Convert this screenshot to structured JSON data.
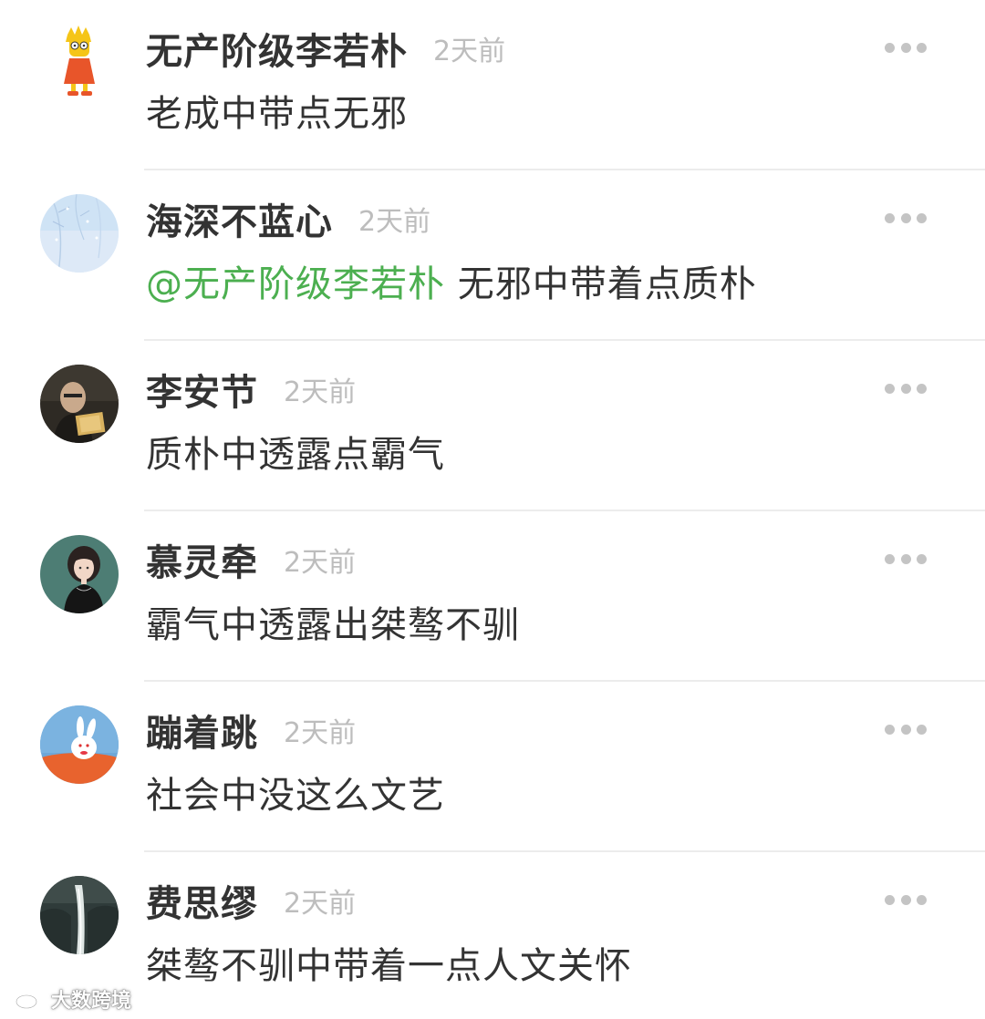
{
  "comments": [
    {
      "avatar_icon": "cartoon-girl-avatar",
      "name": "无产阶级李若朴",
      "time": "2天前",
      "text": "老成中带点无邪",
      "mention": ""
    },
    {
      "avatar_icon": "pale-blue-branches-avatar",
      "name": "海深不蓝心",
      "time": "2天前",
      "mention": "@无产阶级李若朴",
      "text": " 无邪中带着点质朴"
    },
    {
      "avatar_icon": "man-reading-avatar",
      "name": "李安节",
      "time": "2天前",
      "text": "质朴中透露点霸气",
      "mention": ""
    },
    {
      "avatar_icon": "girl-portrait-avatar",
      "name": "慕灵牵",
      "time": "2天前",
      "text": "霸气中透露出桀骜不驯",
      "mention": ""
    },
    {
      "avatar_icon": "bunny-toy-avatar",
      "name": "蹦着跳",
      "time": "2天前",
      "text": "社会中没这么文艺",
      "mention": ""
    },
    {
      "avatar_icon": "waterfall-landscape-avatar",
      "name": "费思缪",
      "time": "2天前",
      "text": "桀骜不驯中带着一点人文关怀",
      "mention": ""
    }
  ],
  "more_icon": "more-dots-icon",
  "mention_color": "#4caf50",
  "watermark": {
    "icon": "weibo-logo-icon",
    "text": "大数跨境"
  }
}
